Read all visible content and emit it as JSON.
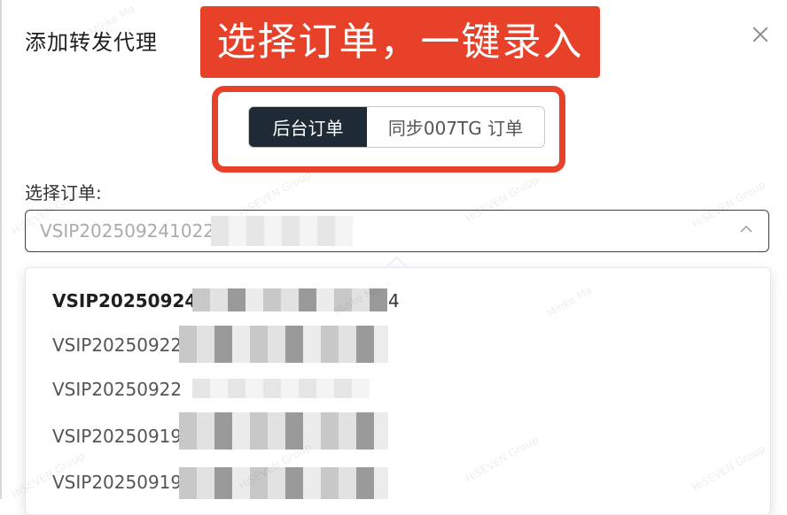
{
  "dialog": {
    "title": "添加转发代理"
  },
  "banner": {
    "text": "选择订单，一键录入"
  },
  "tabs": {
    "backend": "后台订单",
    "sync": "同步007TG 订单"
  },
  "form": {
    "select_label": "选择订单:",
    "selected_value": "VSIP2025092410224"
  },
  "options": [
    {
      "label": "VSIP20250924",
      "tail": "4"
    },
    {
      "label": "VSIP20250922",
      "tail": ""
    },
    {
      "label": "VSIP20250922",
      "tail": ""
    },
    {
      "label": "VSIP20250919",
      "tail": ""
    },
    {
      "label": "VSIP20250919",
      "tail": ""
    }
  ],
  "watermarks": {
    "a": "HiSEVEN Group",
    "b": "Minke Ma"
  },
  "colors": {
    "accent_red": "#e8412a",
    "active_tab": "#1f2a37"
  }
}
